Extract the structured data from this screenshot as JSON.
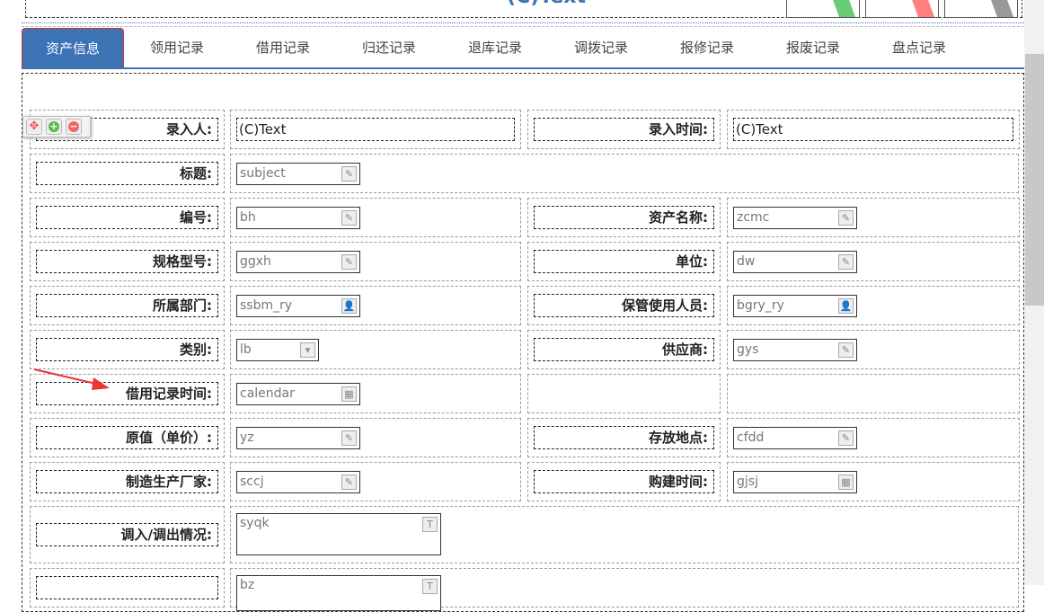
{
  "header": {
    "title": "(C)Text",
    "flag_colors": [
      "#66cc77",
      "#ff8080",
      "#999999"
    ]
  },
  "tabs": [
    {
      "label": "资产信息",
      "active": true
    },
    {
      "label": "领用记录"
    },
    {
      "label": "借用记录"
    },
    {
      "label": "归还记录"
    },
    {
      "label": "退库记录"
    },
    {
      "label": "调拨记录"
    },
    {
      "label": "报修记录"
    },
    {
      "label": "报废记录"
    },
    {
      "label": "盘点记录"
    }
  ],
  "toolbar": {
    "move": "move-icon",
    "add": "add-icon",
    "remove": "remove-icon"
  },
  "rows": [
    {
      "h": 48,
      "cells": [
        {
          "label": "录入人:",
          "text": "(C)Text"
        },
        {
          "label": "录入时间:",
          "text": "(C)Text"
        }
      ]
    },
    {
      "h": 48,
      "cells": [
        {
          "label": "标题:",
          "input": "subject",
          "icon": "edit",
          "full": true
        }
      ]
    },
    {
      "h": 48,
      "cells": [
        {
          "label": "编号:",
          "input": "bh",
          "icon": "edit"
        },
        {
          "label": "资产名称:",
          "input": "zcmc",
          "icon": "edit"
        }
      ]
    },
    {
      "h": 48,
      "cells": [
        {
          "label": "规格型号:",
          "input": "ggxh",
          "icon": "edit"
        },
        {
          "label": "单位:",
          "input": "dw",
          "icon": "edit"
        }
      ]
    },
    {
      "h": 48,
      "cells": [
        {
          "label": "所属部门:",
          "input": "ssbm_ry",
          "icon": "user"
        },
        {
          "label": "保管使用人员:",
          "input": "bgry_ry",
          "icon": "user"
        }
      ]
    },
    {
      "h": 48,
      "cells": [
        {
          "label": "类别:",
          "input": "lb",
          "icon": "select"
        },
        {
          "label": "供应商:",
          "input": "gys",
          "icon": "edit"
        }
      ]
    },
    {
      "h": 48,
      "cells": [
        {
          "label": "借用记录时间:",
          "input": "calendar",
          "icon": "calendar"
        },
        {
          "empty": true
        }
      ]
    },
    {
      "h": 48,
      "cells": [
        {
          "label": "原值（单价）:",
          "input": "yz",
          "icon": "edit"
        },
        {
          "label": "存放地点:",
          "input": "cfdd",
          "icon": "edit"
        }
      ]
    },
    {
      "h": 48,
      "cells": [
        {
          "label": "制造生产厂家:",
          "input": "sccj",
          "icon": "edit"
        },
        {
          "label": "购建时间:",
          "input": "gjsj",
          "icon": "calendar"
        }
      ]
    },
    {
      "h": 68,
      "cells": [
        {
          "label": "调入/调出情况:",
          "area": "syqk",
          "full": true
        }
      ]
    },
    {
      "h": 48,
      "cells": [
        {
          "label": "",
          "area": "bz",
          "full": true
        }
      ]
    }
  ]
}
